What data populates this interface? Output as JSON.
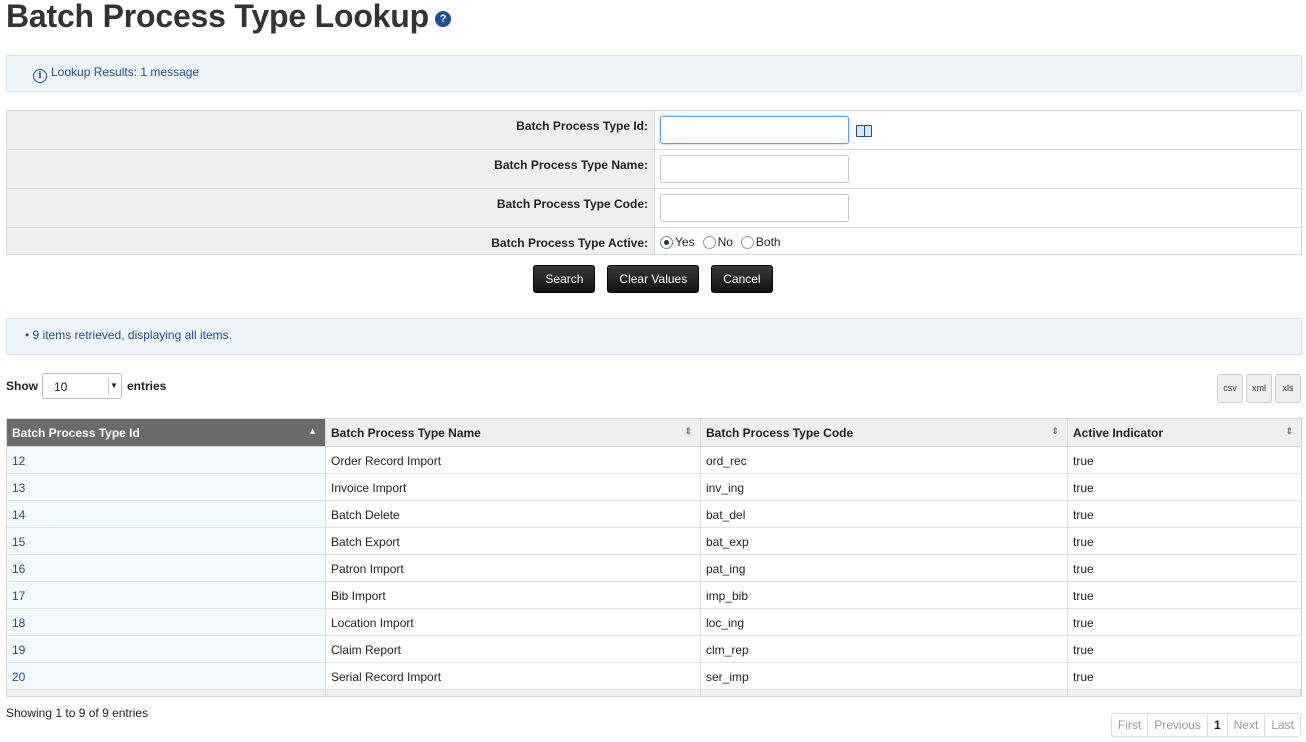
{
  "title": "Batch Process Type Lookup",
  "help_glyph": "?",
  "lookup_message": "Lookup Results: 1 message",
  "criteria": {
    "id_label": "Batch Process Type Id:",
    "id_value": "",
    "name_label": "Batch Process Type Name:",
    "name_value": "",
    "code_label": "Batch Process Type Code:",
    "code_value": "",
    "active_label": "Batch Process Type Active:",
    "active_options": [
      "Yes",
      "No",
      "Both"
    ],
    "active_selected": "Yes"
  },
  "buttons": {
    "search": "Search",
    "clear": "Clear Values",
    "cancel": "Cancel"
  },
  "results_message": "• 9 items retrieved, displaying all items.",
  "show_label": "Show",
  "entries_label": "entries",
  "page_size": "10",
  "export": [
    "csv",
    "xml",
    "xls"
  ],
  "table": {
    "headers": [
      "Batch Process Type Id",
      "Batch Process Type Name",
      "Batch Process Type Code",
      "Active Indicator"
    ],
    "rows": [
      [
        "12",
        "Order Record Import",
        "ord_rec",
        "true"
      ],
      [
        "13",
        "Invoice Import",
        "inv_ing",
        "true"
      ],
      [
        "14",
        "Batch Delete",
        "bat_del",
        "true"
      ],
      [
        "15",
        "Batch Export",
        "bat_exp",
        "true"
      ],
      [
        "16",
        "Patron Import",
        "pat_ing",
        "true"
      ],
      [
        "17",
        "Bib Import",
        "imp_bib",
        "true"
      ],
      [
        "18",
        "Location Import",
        "loc_ing",
        "true"
      ],
      [
        "19",
        "Claim Report",
        "clm_rep",
        "true"
      ],
      [
        "20",
        "Serial Record Import",
        "ser_imp",
        "true"
      ]
    ]
  },
  "showing_text": "Showing 1 to 9 of 9 entries",
  "pager": {
    "first": "First",
    "previous": "Previous",
    "current": "1",
    "next": "Next",
    "last": "Last"
  }
}
